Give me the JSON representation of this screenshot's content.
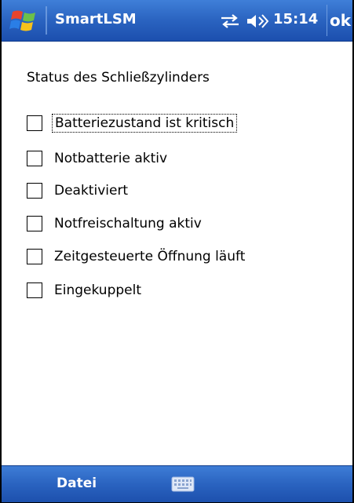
{
  "titlebar": {
    "app_title": "SmartLSM",
    "clock": "15:14",
    "ok_label": "ok",
    "icons": [
      "windows-logo",
      "network-icon",
      "volume-icon"
    ]
  },
  "content": {
    "heading": "Status des Schließzylinders",
    "options": [
      {
        "label": "Batteriezustand ist kritisch",
        "checked": false,
        "focused": true
      },
      {
        "label": "Notbatterie aktiv",
        "checked": false
      },
      {
        "label": "Deaktiviert",
        "checked": false
      },
      {
        "label": "Notfreischaltung aktiv",
        "checked": false
      },
      {
        "label": "Zeitgesteuerte Öffnung läuft",
        "checked": false
      },
      {
        "label": "Eingekuppelt",
        "checked": false
      }
    ]
  },
  "menubar": {
    "left_label": "Datei",
    "center_icon": "keyboard-icon"
  },
  "colors": {
    "bar_blue": "#2a63c0",
    "text": "#000000",
    "background": "#ffffff"
  }
}
